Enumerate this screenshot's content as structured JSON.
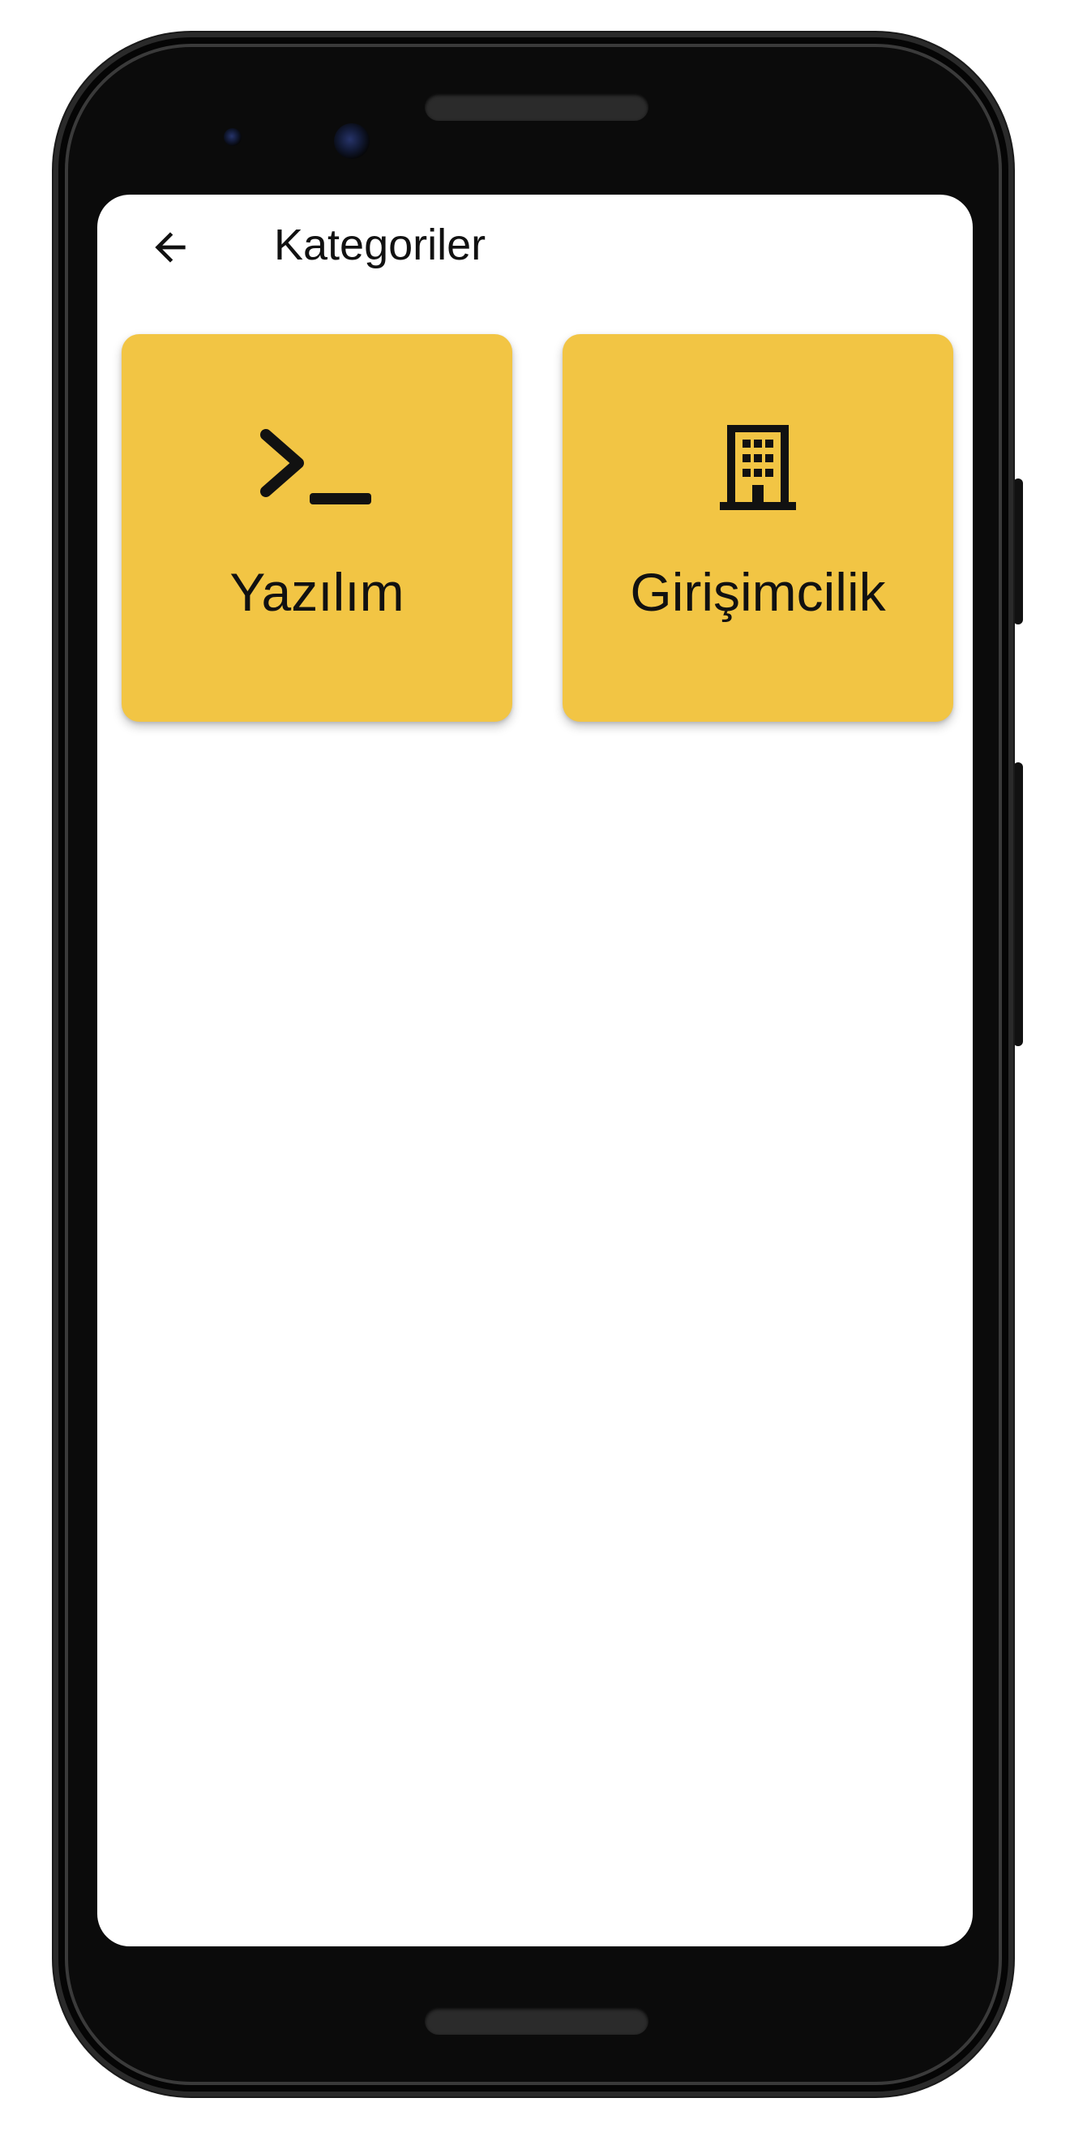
{
  "app": {
    "title": "Kategoriler",
    "back_icon": "arrow-left-icon"
  },
  "categories": [
    {
      "label": "Yazılım",
      "icon": "terminal-icon"
    },
    {
      "label": "Girişimcilik",
      "icon": "building-icon"
    }
  ],
  "colors": {
    "card_background": "#f2c544",
    "text": "#111111",
    "screen_background": "#ffffff"
  }
}
